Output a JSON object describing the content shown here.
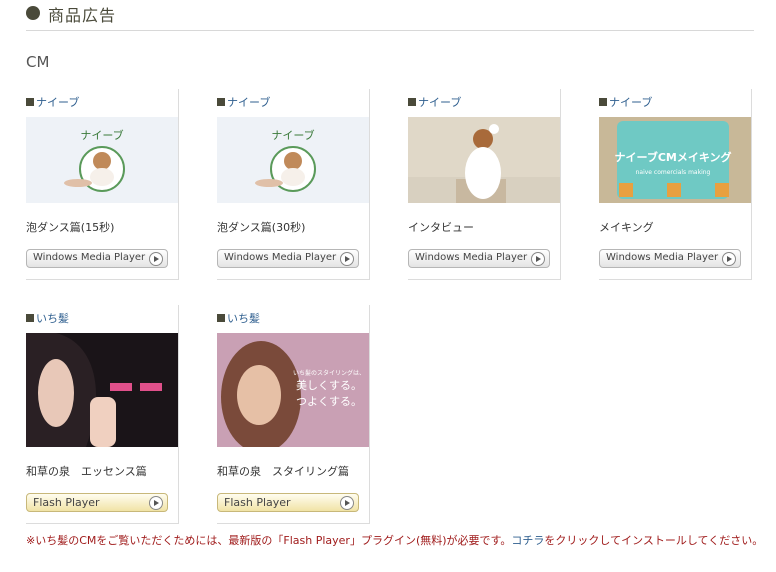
{
  "header": {
    "title": "商品広告"
  },
  "section": {
    "title": "CM"
  },
  "cards": [
    {
      "brand": "ナイーブ",
      "caption": "泡ダンス篇(15秒)",
      "button": "Windows Media Player",
      "thumb_logo": "ナイーブ"
    },
    {
      "brand": "ナイーブ",
      "caption": "泡ダンス篇(30秒)",
      "button": "Windows Media Player",
      "thumb_logo": "ナイーブ"
    },
    {
      "brand": "ナイーブ",
      "caption": "インタビュー",
      "button": "Windows Media Player"
    },
    {
      "brand": "ナイーブ",
      "caption": "メイキング",
      "button": "Windows Media Player",
      "thumb_title": "ナイーブCMメイキング",
      "thumb_sub": "naive comercials making"
    },
    {
      "brand": "いち髪",
      "caption": "和草の泉　エッセンス篇",
      "button": "Flash Player"
    },
    {
      "brand": "いち髪",
      "caption": "和草の泉　スタイリング篇",
      "button": "Flash Player",
      "thumb_line1": "いち髪のスタイリングは、",
      "thumb_line2": "美しくする。",
      "thumb_line3": "つよくする。"
    }
  ],
  "notice": {
    "before": "※いち髪のCMをご覧いただくためには、最新版の「Flash Player」プラグイン(無料)が必要です。",
    "link": "コチラ",
    "after": "をクリックしてインストールしてください。"
  }
}
